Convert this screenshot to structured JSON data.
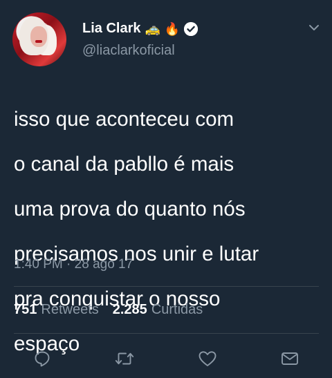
{
  "user": {
    "display_name": "Lia Clark",
    "emojis": [
      "🚕",
      "🔥"
    ],
    "handle": "@liaclarkoficial",
    "verified": true
  },
  "tweet": {
    "lines": [
      "isso que aconteceu com",
      "o canal da pabllo é mais",
      "uma prova do quanto nós",
      "precisamos nos unir e lutar",
      "pra conquistar o nosso",
      "espaço"
    ],
    "time": "1:40 PM",
    "separator": "·",
    "date": "28 ago 17"
  },
  "stats": {
    "retweets_count": "751",
    "retweets_label": "Retweets",
    "likes_count": "2.285",
    "likes_label": "Curtidas"
  },
  "actions": [
    "reply-icon",
    "retweet-icon",
    "like-icon",
    "message-icon"
  ],
  "colors": {
    "background": "#1b2836",
    "text": "#ffffff",
    "secondary": "#8b98a5",
    "divider": "#38444d"
  }
}
